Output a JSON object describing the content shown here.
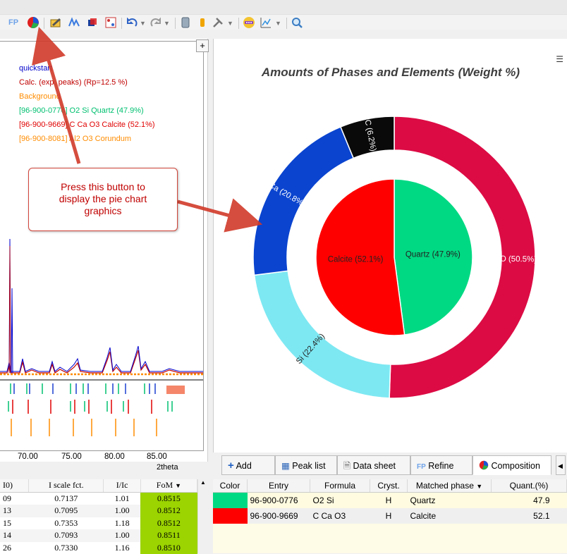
{
  "toolbar": {
    "fp_label": "FP",
    "icons": [
      "fp-icon",
      "pie-chart-icon",
      "edit-icon",
      "peaks-icon",
      "cube-icon",
      "structure-icon",
      "undo-icon",
      "redo-icon",
      "database-icon",
      "cylinder-icon",
      "tools-icon",
      "color-wheel-icon",
      "chart-settings-icon",
      "search-icon"
    ]
  },
  "pattern_panel": {
    "legend": [
      {
        "text": "quickstart",
        "color": "#0000cc"
      },
      {
        "text": "Calc. (exp. peaks) (Rp=12.5 %)",
        "color": "#c00000"
      },
      {
        "text": "Background",
        "color": "#ff8c00"
      },
      {
        "text": "[96-900-0776] O2 Si Quartz (47.9%)",
        "color": "#00c070"
      },
      {
        "text": "[96-900-9669] C Ca O3 Calcite (52.1%)",
        "color": "#e00000"
      },
      {
        "text": "[96-900-8081] Al2 O3 Corundum",
        "color": "#ff8c00"
      }
    ],
    "x_ticks": [
      "70.00",
      "75.00",
      "80.00",
      "85.00"
    ],
    "x_axis_label": "2theta",
    "plus_label": "+"
  },
  "callout": {
    "lines": [
      "Press this button to",
      "display the pie chart",
      "graphics"
    ]
  },
  "chart_data": {
    "type": "pie",
    "title": "Amounts of Phases and Elements (Weight %)",
    "inner_ring": [
      {
        "label": "Quartz (47.9%)",
        "value": 47.9,
        "color": "#00d983"
      },
      {
        "label": "Calcite (52.1%)",
        "value": 52.1,
        "color": "#ff0000"
      }
    ],
    "outer_ring": [
      {
        "label": "O (50.5%)",
        "value": 50.5,
        "color": "#dc0b44"
      },
      {
        "label": "Si (22.4%)",
        "value": 22.4,
        "color": "#7de8f2"
      },
      {
        "label": "Ca (20.8%)",
        "value": 20.8,
        "color": "#0a44cf"
      },
      {
        "label": "C (6.2%)",
        "value": 6.2,
        "color": "#0a0a0a"
      }
    ]
  },
  "tabs": [
    {
      "icon": "plus-icon",
      "label": "Add"
    },
    {
      "icon": "table-icon",
      "label": "Peak list"
    },
    {
      "icon": "document-icon",
      "label": "Data sheet"
    },
    {
      "icon": "fp-icon",
      "label": "Refine",
      "prefix": "FP"
    },
    {
      "icon": "pie-chart-icon",
      "label": "Composition",
      "active": true
    }
  ],
  "left_table": {
    "headers": [
      "I0)",
      "I scale fct.",
      "I/Ic",
      "FoM"
    ],
    "rows": [
      [
        "09",
        "0.7137",
        "1.01",
        "0.8515"
      ],
      [
        "13",
        "0.7095",
        "1.00",
        "0.8512"
      ],
      [
        "15",
        "0.7353",
        "1.18",
        "0.8512"
      ],
      [
        "14",
        "0.7093",
        "1.00",
        "0.8511"
      ],
      [
        "26",
        "0.7330",
        "1.16",
        "0.8510"
      ]
    ]
  },
  "right_table": {
    "headers": [
      "Color",
      "Entry",
      "Formula",
      "Cryst.",
      "Matched phase",
      "Quant.(%)"
    ],
    "rows": [
      {
        "color": "#00d983",
        "entry": "96-900-0776",
        "formula": "O2 Si",
        "cryst": "H",
        "phase": "Quartz",
        "quant": "47.9"
      },
      {
        "color": "#ff0000",
        "entry": "96-900-9669",
        "formula": "C Ca O3",
        "cryst": "H",
        "phase": "Calcite",
        "quant": "52.1"
      }
    ]
  }
}
